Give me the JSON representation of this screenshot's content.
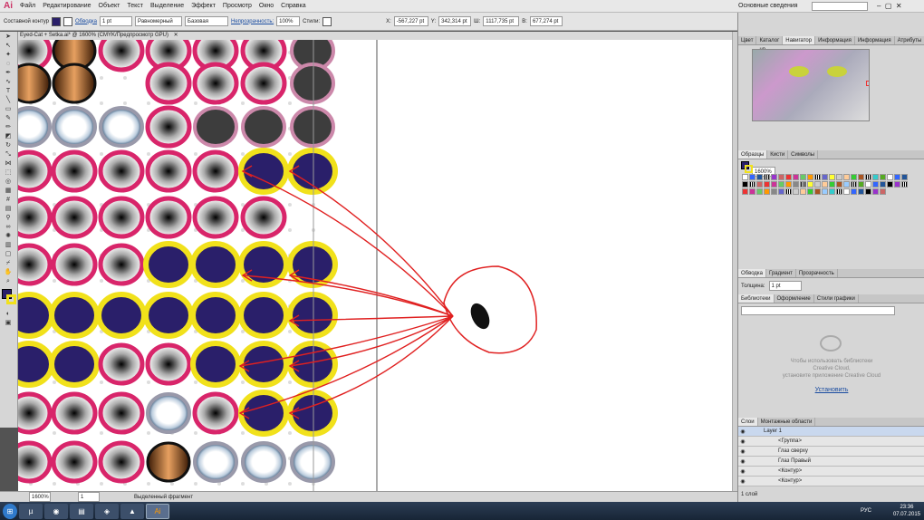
{
  "menubar": {
    "logo": "Ai",
    "items": [
      "Файл",
      "Редактирование",
      "Объект",
      "Текст",
      "Выделение",
      "Эффект",
      "Просмотр",
      "Окно",
      "Справка"
    ],
    "workspace": "Основные сведения",
    "search_placeholder": ""
  },
  "control_bar": {
    "label": "Составной контур",
    "stroke_label": "Обводка",
    "stroke_width": "1 pt",
    "profile": "Равномерный",
    "brush": "Базовая",
    "opacity_label": "Непрозрачность:",
    "opacity": "100%",
    "styles_label": "Стили:",
    "x_label": "X:",
    "x": "-567,227 pt",
    "y_label": "Y:",
    "y": "342,314 pt",
    "w_label": "Ш:",
    "w": "1117,735 pt",
    "h_label": "В:",
    "h": "677,274 pt"
  },
  "document_tab": "Eyed-Cat + Setka.ai* @ 1600% (CMYK/Предпросмотр GPU)",
  "status": {
    "zoom": "1600%",
    "page": "1",
    "tool": "Выделенный фрагмент"
  },
  "panels": {
    "navigator_tabs": [
      "Цвет",
      "Каталог цв",
      "Навигатор",
      "Информация",
      "Информация",
      "Атрибуты"
    ],
    "navigator_zoom": "1600%",
    "swatches_tabs": [
      "Образцы",
      "Кисти",
      "Символы"
    ],
    "stroke_tabs": [
      "Обводка",
      "Градиент",
      "Прозрачность"
    ],
    "stroke_label": "Толщина:",
    "stroke_value": "1 pt",
    "libraries_tabs": [
      "Библиотеки",
      "Оформление",
      "Стили графики"
    ],
    "cc_message_1": "Чтобы использовать библиотеки",
    "cc_message_2": "Creative Cloud,",
    "cc_message_3": "установите приложение Creative Cloud",
    "cc_install": "Установить",
    "layers_tabs": [
      "Слои",
      "Монтажные области"
    ],
    "layers": [
      {
        "name": "Layer 1",
        "selected": true
      },
      {
        "name": "<Группа>",
        "selected": false
      },
      {
        "name": "Глаз сверху",
        "selected": false
      },
      {
        "name": "Глаз Правый",
        "selected": false
      },
      {
        "name": "<Контур>",
        "selected": false
      },
      {
        "name": "<Контур>",
        "selected": false
      }
    ],
    "layers_count": "1 слой"
  },
  "taskbar": {
    "time": "23:36",
    "date": "07.07.2015",
    "lang": "РУС",
    "apps": [
      "utorrent",
      "firefox",
      "explorer",
      "app4",
      "app5",
      "illustrator"
    ]
  },
  "colors": {
    "pink": "#d8256a",
    "navy": "#2a1f6a",
    "yellow": "#f1e11b",
    "scribble": "#e02020"
  }
}
